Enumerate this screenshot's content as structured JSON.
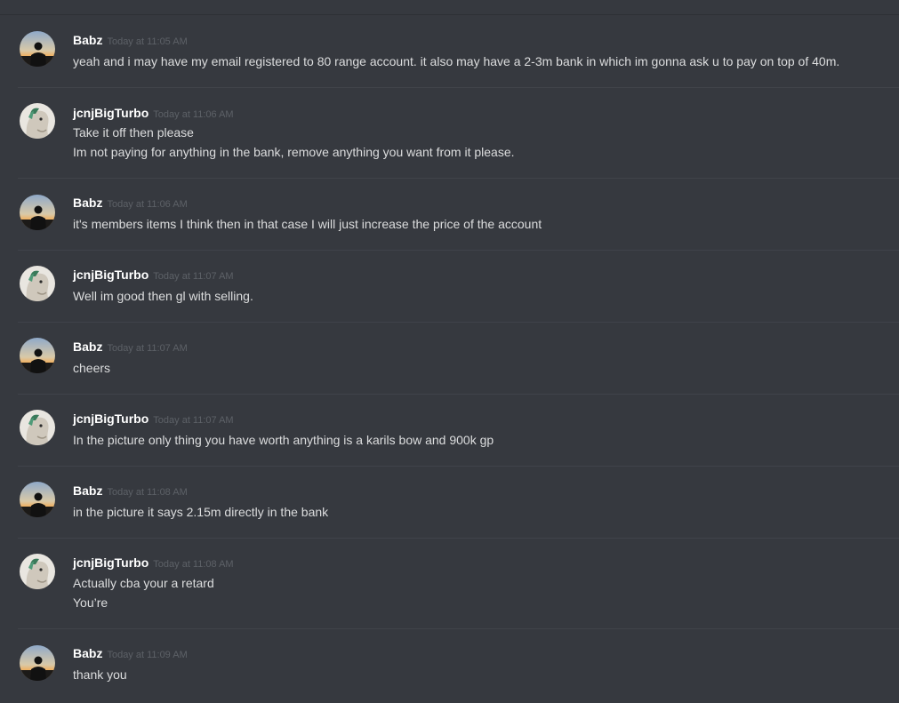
{
  "messages": [
    {
      "username": "Babz",
      "timestamp": "Today at 11:05 AM",
      "avatar": "sunset-silhouette-avatar",
      "lines": [
        "yeah and i may have my email registered to 80 range account. it also may have a 2-3m bank in which im gonna ask u to pay on top of 40m."
      ]
    },
    {
      "username": "jcnjBigTurbo",
      "timestamp": "Today at 11:06 AM",
      "avatar": "horse-avatar",
      "lines": [
        "Take it off then please",
        "Im not paying for anything in the bank, remove anything you want from it please."
      ]
    },
    {
      "username": "Babz",
      "timestamp": "Today at 11:06 AM",
      "avatar": "sunset-silhouette-avatar",
      "lines": [
        "it's members items I think then in that case I will just increase the price of the account"
      ]
    },
    {
      "username": "jcnjBigTurbo",
      "timestamp": "Today at 11:07 AM",
      "avatar": "horse-avatar",
      "lines": [
        "Well im good then gl with selling."
      ]
    },
    {
      "username": "Babz",
      "timestamp": "Today at 11:07 AM",
      "avatar": "sunset-silhouette-avatar",
      "lines": [
        "cheers"
      ]
    },
    {
      "username": "jcnjBigTurbo",
      "timestamp": "Today at 11:07 AM",
      "avatar": "horse-avatar",
      "lines": [
        "In the picture only thing you have worth anything is a karils bow and 900k gp"
      ]
    },
    {
      "username": "Babz",
      "timestamp": "Today at 11:08 AM",
      "avatar": "sunset-silhouette-avatar",
      "lines": [
        "in the picture it says 2.15m directly in the bank"
      ]
    },
    {
      "username": "jcnjBigTurbo",
      "timestamp": "Today at 11:08 AM",
      "avatar": "horse-avatar",
      "lines": [
        "Actually cba your a retard",
        "You’re"
      ]
    },
    {
      "username": "Babz",
      "timestamp": "Today at 11:09 AM",
      "avatar": "sunset-silhouette-avatar",
      "lines": [
        "thank you"
      ]
    }
  ],
  "colors": {
    "background": "#36393f",
    "username": "#ffffff",
    "timestamp": "#5d6167",
    "message_text": "#dcddde",
    "divider": "#40434a"
  }
}
